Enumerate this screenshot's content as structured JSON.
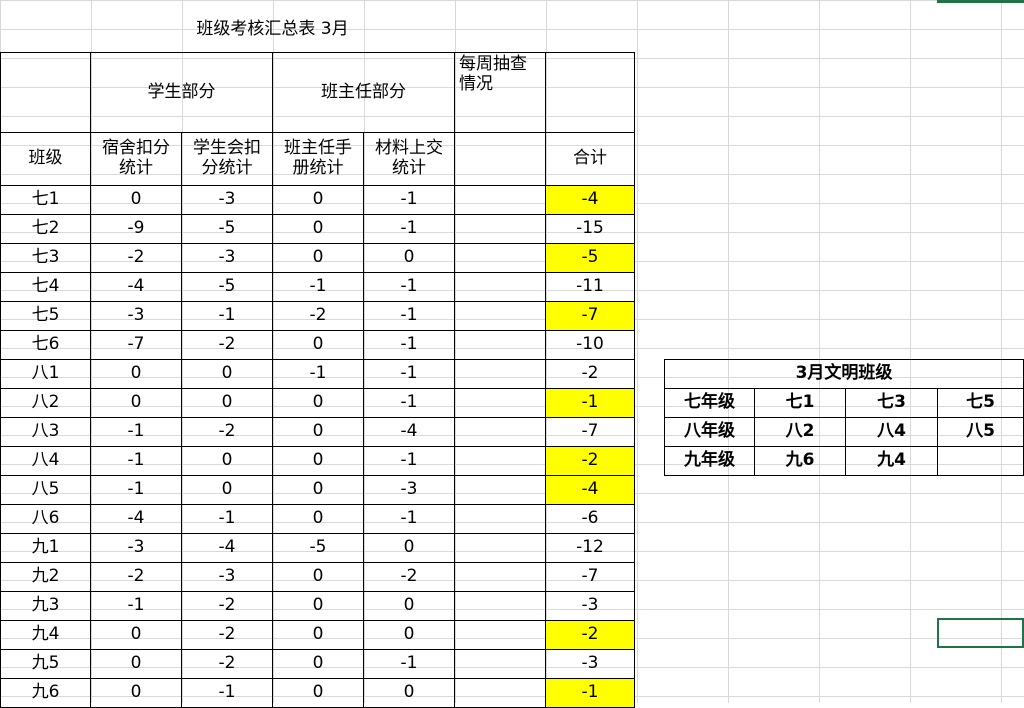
{
  "sheet": {
    "title": "班级考核汇总表  3月",
    "groups": {
      "student": "学生部分",
      "teacher": "班主任部分",
      "weekly": "每周抽查\n情况"
    },
    "headers": {
      "class": "班级",
      "dorm": "宿舍扣分\n统计",
      "union": "学生会扣\n分统计",
      "manual": "班主任手\n册统计",
      "material": "材料上交\n统计",
      "weekly": "",
      "total": "合计"
    },
    "rows": [
      {
        "class": "七1",
        "dorm": "0",
        "union": "-3",
        "manual": "0",
        "material": "-1",
        "weekly": "",
        "total": "-4",
        "hl": true
      },
      {
        "class": "七2",
        "dorm": "-9",
        "union": "-5",
        "manual": "0",
        "material": "-1",
        "weekly": "",
        "total": "-15",
        "hl": false
      },
      {
        "class": "七3",
        "dorm": "-2",
        "union": "-3",
        "manual": "0",
        "material": "0",
        "weekly": "",
        "total": "-5",
        "hl": true
      },
      {
        "class": "七4",
        "dorm": "-4",
        "union": "-5",
        "manual": "-1",
        "material": "-1",
        "weekly": "",
        "total": "-11",
        "hl": false
      },
      {
        "class": "七5",
        "dorm": "-3",
        "union": "-1",
        "manual": "-2",
        "material": "-1",
        "weekly": "",
        "total": "-7",
        "hl": true
      },
      {
        "class": "七6",
        "dorm": "-7",
        "union": "-2",
        "manual": "0",
        "material": "-1",
        "weekly": "",
        "total": "-10",
        "hl": false
      },
      {
        "class": "八1",
        "dorm": "0",
        "union": "0",
        "manual": "-1",
        "material": "-1",
        "weekly": "",
        "total": "-2",
        "hl": false
      },
      {
        "class": "八2",
        "dorm": "0",
        "union": "0",
        "manual": "0",
        "material": "-1",
        "weekly": "",
        "total": "-1",
        "hl": true
      },
      {
        "class": "八3",
        "dorm": "-1",
        "union": "-2",
        "manual": "0",
        "material": "-4",
        "weekly": "",
        "total": "-7",
        "hl": false
      },
      {
        "class": "八4",
        "dorm": "-1",
        "union": "0",
        "manual": "0",
        "material": "-1",
        "weekly": "",
        "total": "-2",
        "hl": true
      },
      {
        "class": "八5",
        "dorm": "-1",
        "union": "0",
        "manual": "0",
        "material": "-3",
        "weekly": "",
        "total": "-4",
        "hl": true
      },
      {
        "class": "八6",
        "dorm": "-4",
        "union": "-1",
        "manual": "0",
        "material": "-1",
        "weekly": "",
        "total": "-6",
        "hl": false
      },
      {
        "class": "九1",
        "dorm": "-3",
        "union": "-4",
        "manual": "-5",
        "material": "0",
        "weekly": "",
        "total": "-12",
        "hl": false
      },
      {
        "class": "九2",
        "dorm": "-2",
        "union": "-3",
        "manual": "0",
        "material": "-2",
        "weekly": "",
        "total": "-7",
        "hl": false
      },
      {
        "class": "九3",
        "dorm": "-1",
        "union": "-2",
        "manual": "0",
        "material": "0",
        "weekly": "",
        "total": "-3",
        "hl": false
      },
      {
        "class": "九4",
        "dorm": "0",
        "union": "-2",
        "manual": "0",
        "material": "0",
        "weekly": "",
        "total": "-2",
        "hl": true
      },
      {
        "class": "九5",
        "dorm": "0",
        "union": "-2",
        "manual": "0",
        "material": "-1",
        "weekly": "",
        "total": "-3",
        "hl": false
      },
      {
        "class": "九6",
        "dorm": "0",
        "union": "-1",
        "manual": "0",
        "material": "0",
        "weekly": "",
        "total": "-1",
        "hl": true
      }
    ],
    "highlight_color": "#ffff00"
  },
  "civilized": {
    "title": "3月文明班级",
    "rows": [
      {
        "grade": "七年级",
        "c1": "七1",
        "c2": "七3",
        "c3": "七5"
      },
      {
        "grade": "八年级",
        "c1": "八2",
        "c2": "八4",
        "c3": "八5"
      },
      {
        "grade": "九年级",
        "c1": "九6",
        "c2": "九4",
        "c3": ""
      }
    ]
  },
  "selection_color": "#217346"
}
